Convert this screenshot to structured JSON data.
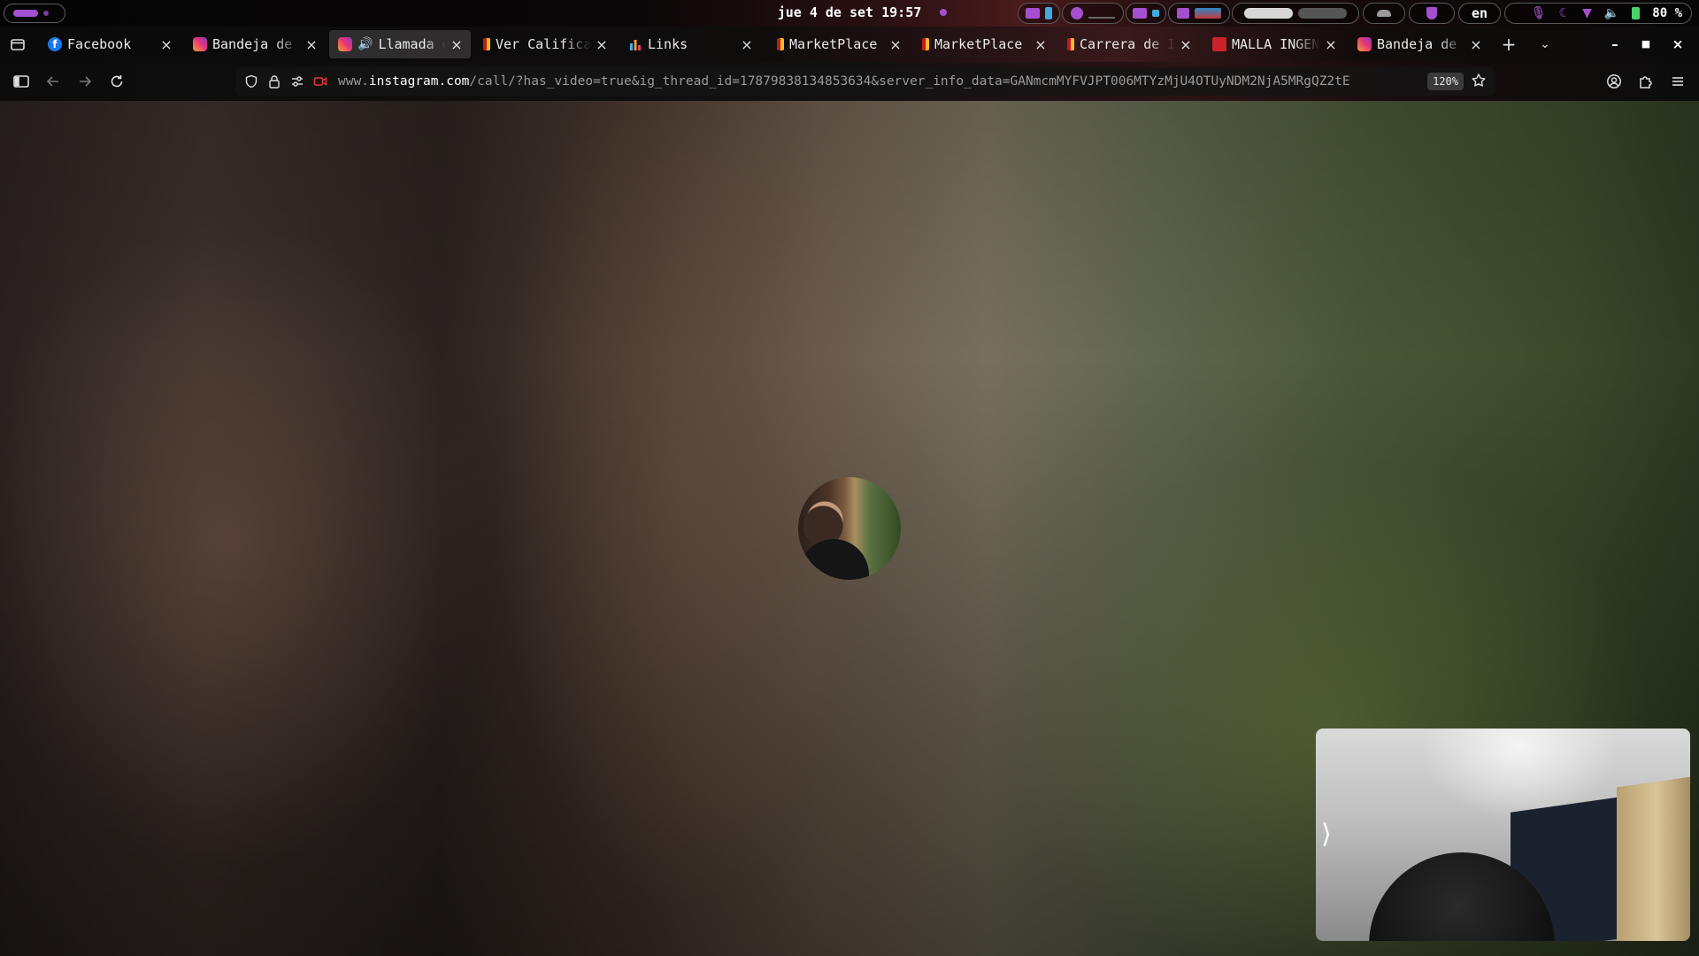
{
  "system_bar": {
    "clock": "jue 4 de set 19:57",
    "language": "en",
    "battery": "80 %"
  },
  "browser": {
    "tabs": [
      {
        "title": "Facebook",
        "favicon": "facebook-icon",
        "active": false
      },
      {
        "title": "Bandeja de e",
        "favicon": "instagram-icon",
        "active": false
      },
      {
        "title": "Llamada de",
        "favicon": "instagram-icon",
        "active": true,
        "audio": true
      },
      {
        "title": "Ver Califica",
        "favicon": "university-icon",
        "active": false
      },
      {
        "title": "Links",
        "favicon": "bar-chart-icon",
        "active": false
      },
      {
        "title": "MarketPlace",
        "favicon": "university-icon",
        "active": false
      },
      {
        "title": "MarketPlace",
        "favicon": "university-icon",
        "active": false
      },
      {
        "title": "Carrera de I",
        "favicon": "university-icon",
        "active": false
      },
      {
        "title": "MALLA INGENI",
        "favicon": "pdf-icon",
        "active": false
      },
      {
        "title": "Bandeja de e",
        "favicon": "instagram-icon",
        "active": false
      }
    ],
    "url": {
      "prefix": "www.",
      "domain": "instagram.com",
      "path": "/call/?has_video=true&ig_thread_id=17879838134853634&server_info_data=GANmcmMYFVJPT006MTYzMjU4OTUyNDM2NjA5MRgQZ2tE"
    },
    "zoom": "120%"
  },
  "call": {
    "self_view_toggle": "⟩"
  }
}
